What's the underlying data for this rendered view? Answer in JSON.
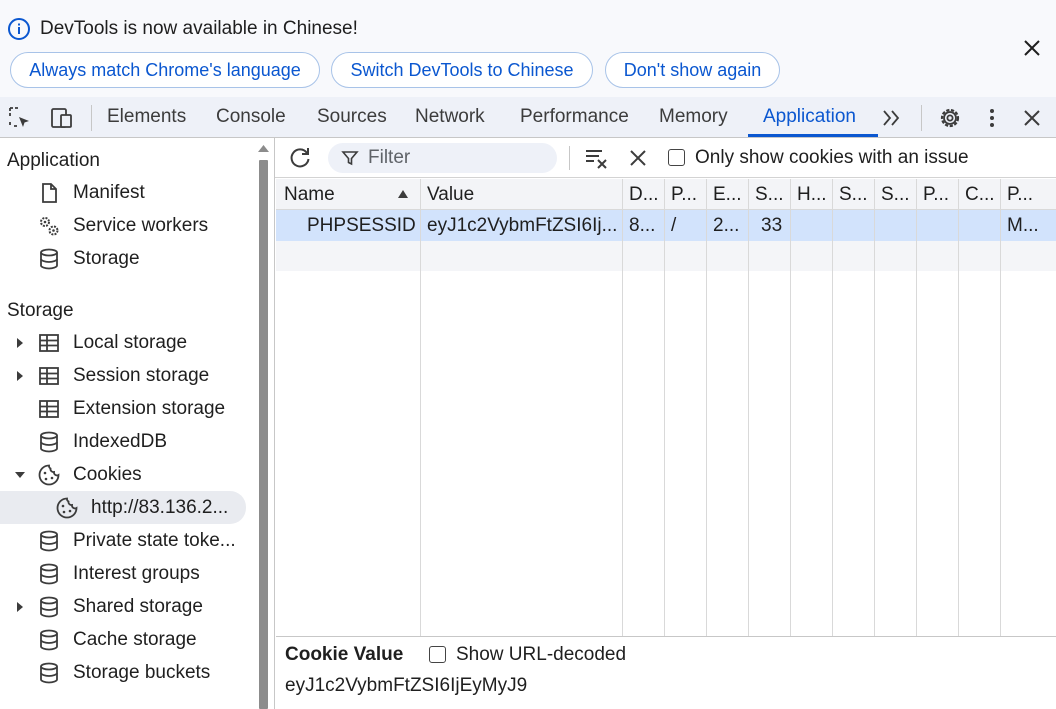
{
  "infobar": {
    "message": "DevTools is now available in Chinese!",
    "buttons": [
      "Always match Chrome's language",
      "Switch DevTools to Chinese",
      "Don't show again"
    ]
  },
  "toolbar": {
    "tabs": [
      "Elements",
      "Console",
      "Sources",
      "Network",
      "Performance",
      "Memory",
      "Application"
    ],
    "active_tab": "Application"
  },
  "sidebar": {
    "application_heading": "Application",
    "application_items": [
      "Manifest",
      "Service workers",
      "Storage"
    ],
    "storage_heading": "Storage",
    "storage_items": [
      "Local storage",
      "Session storage",
      "Extension storage",
      "IndexedDB",
      "Cookies"
    ],
    "cookie_child": "http://83.136.2...",
    "more_items": [
      "Private state toke...",
      "Interest groups",
      "Shared storage",
      "Cache storage",
      "Storage buckets"
    ]
  },
  "main_toolbar": {
    "filter_placeholder": "Filter",
    "only_issue_label": "Only show cookies with an issue"
  },
  "table": {
    "columns": [
      "Name",
      "Value",
      "D...",
      "P...",
      "E...",
      "S...",
      "H...",
      "S...",
      "S...",
      "P...",
      "C...",
      "P..."
    ],
    "rows": [
      [
        "PHPSESSID",
        "eyJ1c2VybmFtZSI6Ij...",
        "8...",
        "/",
        "2...",
        "33",
        "",
        "",
        "",
        "",
        "",
        "M..."
      ]
    ]
  },
  "cookie_value": {
    "title": "Cookie Value",
    "show_decoded_label": "Show URL-decoded",
    "value": "eyJ1c2VybmFtZSI6IjEyMyJ9"
  },
  "colors": {
    "accent": "#0b57d0",
    "selected_row": "#d2e3fc"
  }
}
